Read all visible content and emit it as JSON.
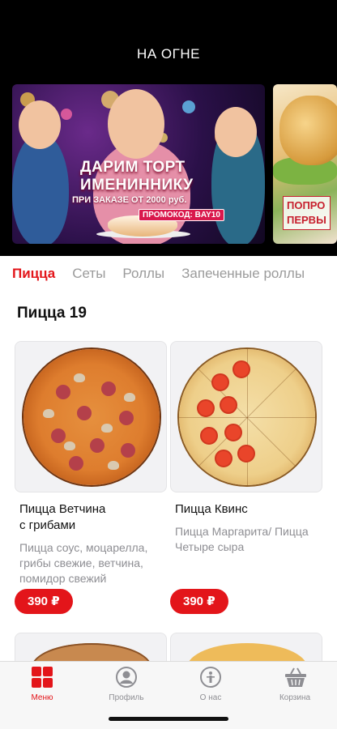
{
  "header": {
    "title": "НА ОГНЕ"
  },
  "banners": [
    {
      "line1": "ДАРИМ ТОРТ",
      "line2": "ИМЕНИННИКУ",
      "line3": "ПРИ ЗАКАЗЕ ОТ 2000 руб.",
      "promo": "ПРОМОКОД: BAY10"
    },
    {
      "text_line1": "ПОПРО",
      "text_line2": "ПЕРВЫ"
    }
  ],
  "category_tabs": [
    {
      "label": "Пицца",
      "active": true
    },
    {
      "label": "Сеты",
      "active": false
    },
    {
      "label": "Роллы",
      "active": false
    },
    {
      "label": "Запеченные роллы",
      "active": false
    }
  ],
  "section": {
    "title": "Пицца 19"
  },
  "products": [
    {
      "name_line1": "Пицца Ветчина",
      "name_line2": "с грибами",
      "description": "Пицца соус, моцарелла, грибы свежие, ветчина, помидор свежий",
      "price": "390 ₽"
    },
    {
      "name_line1": "Пицца Квинс",
      "name_line2": "",
      "description": "Пицца Маргарита/ Пицца Четыре сыра",
      "price": "390 ₽"
    }
  ],
  "tabbar": {
    "items": [
      {
        "label": "Меню",
        "icon": "grid-icon",
        "active": true
      },
      {
        "label": "Профиль",
        "icon": "user-icon",
        "active": false
      },
      {
        "label": "О нас",
        "icon": "info-icon",
        "active": false
      },
      {
        "label": "Корзина",
        "icon": "basket-icon",
        "active": false
      }
    ]
  },
  "colors": {
    "accent": "#e3151a",
    "header_bg": "#000000",
    "muted": "#8e8e93"
  }
}
